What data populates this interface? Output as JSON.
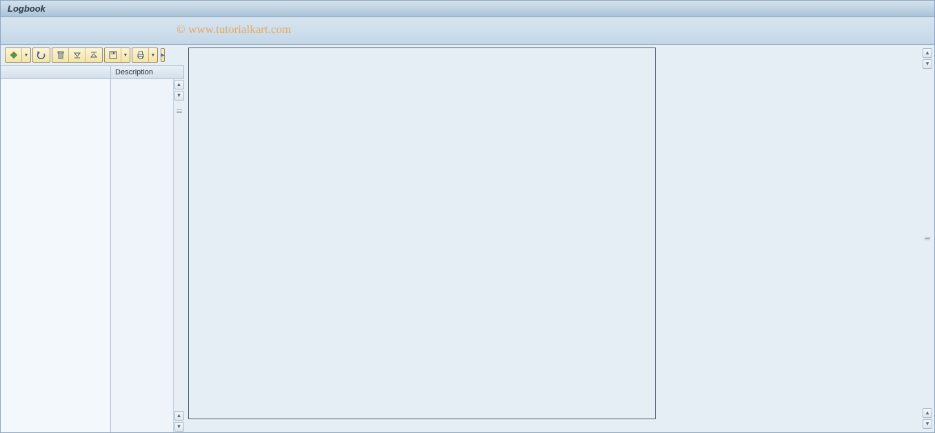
{
  "window": {
    "title": "Logbook"
  },
  "watermark": "© www.tutorialkart.com",
  "toolbar": {
    "buttons": [
      {
        "name": "display-change",
        "icon": "diamond-green"
      },
      {
        "name": "refresh",
        "icon": "refresh"
      },
      {
        "name": "delete",
        "icon": "trash"
      },
      {
        "name": "expand",
        "icon": "expand-down"
      },
      {
        "name": "collapse",
        "icon": "collapse-up"
      },
      {
        "name": "save",
        "icon": "save"
      },
      {
        "name": "print",
        "icon": "print"
      }
    ]
  },
  "table": {
    "columns": {
      "col1": "",
      "col2": "Description"
    }
  }
}
